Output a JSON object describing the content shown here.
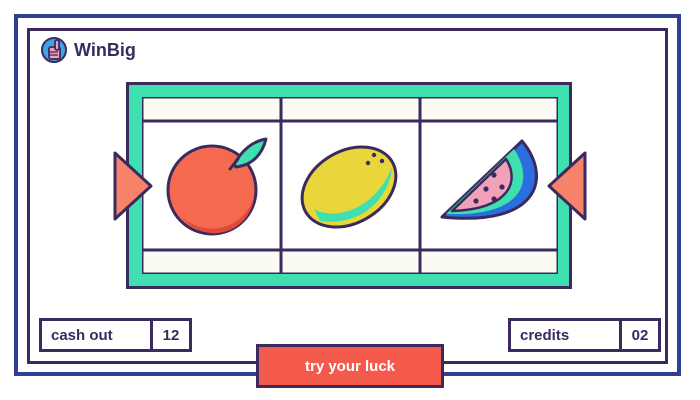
{
  "brand": {
    "name": "WinBig",
    "icon": "hand-icon"
  },
  "reels": [
    {
      "symbol": "orange",
      "icon": "orange-icon"
    },
    {
      "symbol": "lemon",
      "icon": "lemon-icon"
    },
    {
      "symbol": "watermelon",
      "icon": "watermelon-icon"
    }
  ],
  "cash_out": {
    "label": "cash out",
    "value": "12"
  },
  "credits": {
    "label": "credits",
    "value": "02"
  },
  "spin_button": {
    "label": "try your luck"
  },
  "colors": {
    "frame": "#2e3f94",
    "outline": "#3a2a5e",
    "machine": "#3fe0b0",
    "accent": "#f45a4b",
    "arrow": "#f7836a",
    "orange": "#f56a4f",
    "lemon": "#e8d63a",
    "melon_rind": "#2a6ee0",
    "melon_flesh": "#f2a2b8"
  }
}
